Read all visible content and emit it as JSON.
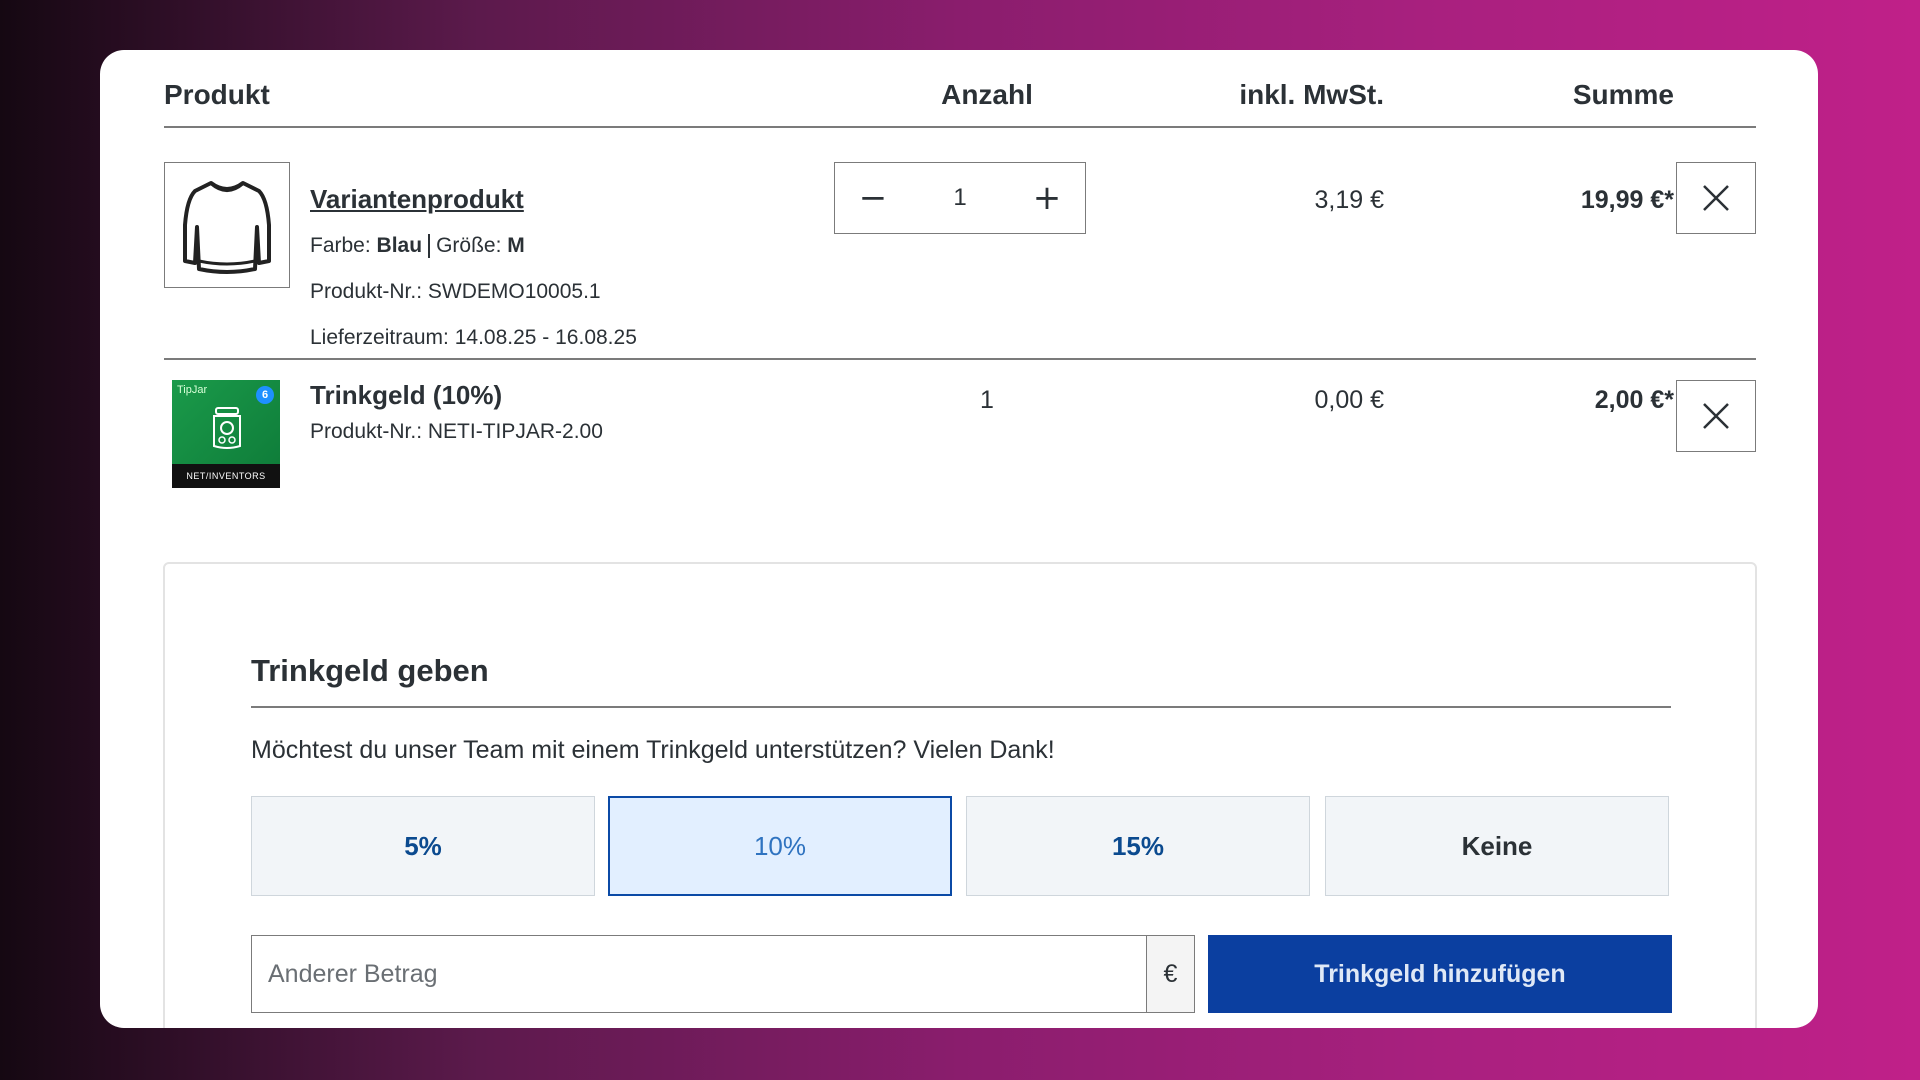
{
  "header": {
    "product": "Produkt",
    "quantity": "Anzahl",
    "vat": "inkl. MwSt.",
    "total": "Summe"
  },
  "items": [
    {
      "name": "Variantenprodukt",
      "color_label": "Farbe:",
      "color_value": "Blau",
      "size_label": "Größe:",
      "size_value": "M",
      "product_no": "Produkt-Nr.: SWDEMO10005.1",
      "delivery": "Lieferzeitraum: 14.08.25 - 16.08.25",
      "quantity": "1",
      "vat": "3,19 €",
      "total": "19,99 €*",
      "thumb_icon": "longsleeve-shirt-icon"
    },
    {
      "name": "Trinkgeld (10%)",
      "product_no": "Produkt-Nr.: NETI-TIPJAR-2.00",
      "quantity": "1",
      "vat": "0,00 €",
      "total": "2,00 €*",
      "thumb_label_top": "TipJar",
      "thumb_badge": "6",
      "thumb_label_bottom": "NET/INVENTORS"
    }
  ],
  "tip": {
    "title": "Trinkgeld geben",
    "description": "Möchtest du unser Team mit einem Trinkgeld unterstützen? Vielen Dank!",
    "options": [
      "5%",
      "10%",
      "15%",
      "Keine"
    ],
    "selected": "10%",
    "amount_placeholder": "Anderer Betrag",
    "currency": "€",
    "add_label": "Trinkgeld hinzufügen"
  },
  "colors": {
    "primary": "#0b3fa0",
    "accent_active_bg": "#e2efff",
    "text": "#2b3136"
  }
}
